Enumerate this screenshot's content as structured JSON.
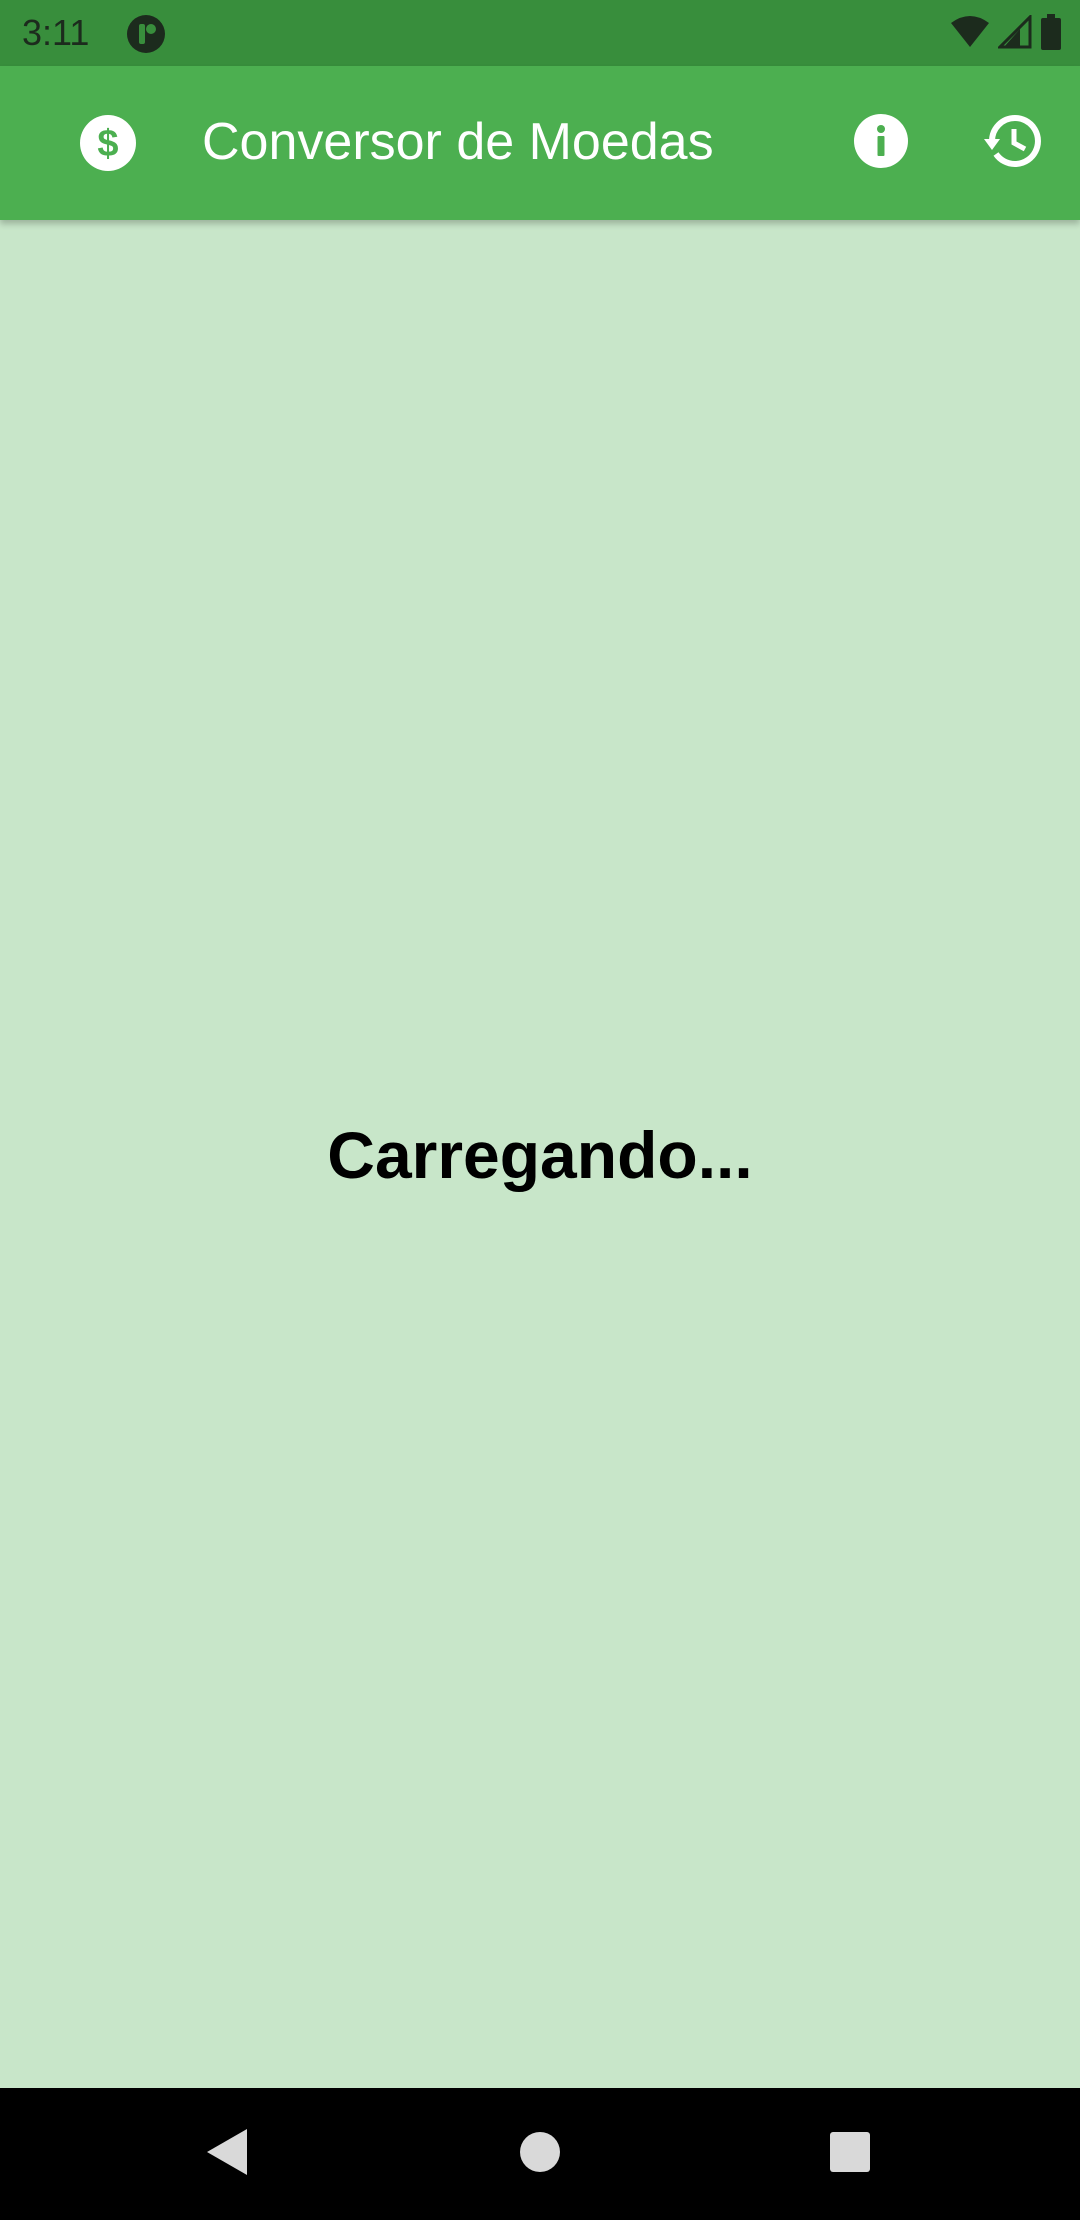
{
  "status_bar": {
    "time": "3:11",
    "icons": [
      "notification-icon",
      "wifi-icon",
      "signal-icon",
      "battery-icon"
    ]
  },
  "app_bar": {
    "title": "Conversor de Moedas",
    "leading_icon": "dollar-circle-icon",
    "actions": [
      "info-icon",
      "history-icon"
    ],
    "color": "#4caf50"
  },
  "main": {
    "loading_text": "Carregando...",
    "background_color": "#c8e6c9"
  },
  "nav_bar": {
    "buttons": [
      "back-icon",
      "home-icon",
      "recents-icon"
    ]
  }
}
